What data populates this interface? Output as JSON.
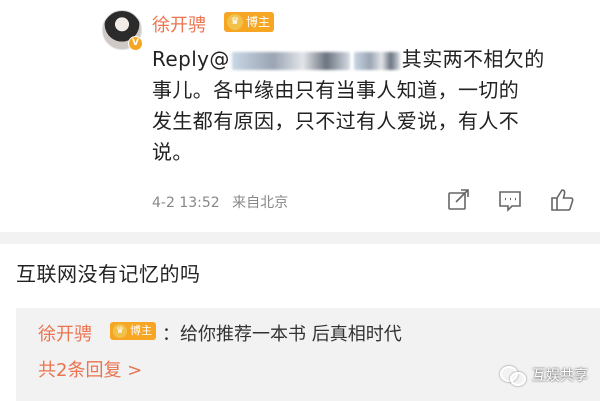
{
  "post": {
    "username": "徐开骋",
    "badge_label": "博主",
    "badge_icon": "crown-icon",
    "verified_icon": "v-badge-icon",
    "content": {
      "prefix": "Reply@",
      "after_blur": "其实两不相欠的",
      "line2": "事儿。各中缘由只有当事人知道，一切的",
      "line3": "发生都有原因，只不过有人爱说，有人不",
      "line4": "说。"
    },
    "timestamp": "4-2 13:52",
    "source": "来自北京",
    "actions": [
      "share-icon",
      "comment-icon",
      "like-icon"
    ]
  },
  "comment": {
    "text": "互联网没有记忆的吗"
  },
  "reply": {
    "username": "徐开骋",
    "badge_label": "博主",
    "text": "：给你推荐一本书 后真相时代",
    "more_link": "共2条回复 >"
  },
  "watermark": {
    "text": "互娱共享"
  },
  "colors": {
    "username": "#eb7350",
    "badge": "#f6a623",
    "divider": "#f2f2f2",
    "meta": "#888888"
  }
}
